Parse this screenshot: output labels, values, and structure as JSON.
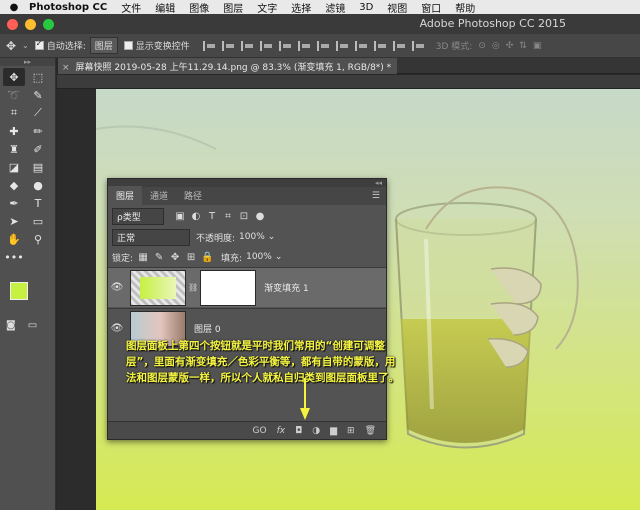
{
  "menubar": {
    "app": "Photoshop CC",
    "items": [
      "文件",
      "编辑",
      "图像",
      "图层",
      "文字",
      "选择",
      "滤镜",
      "3D",
      "视图",
      "窗口",
      "帮助"
    ]
  },
  "window": {
    "title": "Adobe Photoshop CC 2015",
    "traffic_colors": [
      "#ff5f57",
      "#febc2e",
      "#28c840"
    ]
  },
  "options_bar": {
    "auto_select_label": "自动选择:",
    "auto_select_value": "图层",
    "transform_controls_label": "显示变换控件",
    "mode_3d_label": "3D 模式:"
  },
  "document_tab": {
    "close": "×",
    "title": "屏幕快照 2019-05-28 上午11.29.14.png @ 83.3% (渐变填充 1, RGB/8*) *"
  },
  "colors": {
    "foreground": "#c6f042",
    "background": "#ffffff",
    "accent": "#f4f440"
  },
  "layers_panel": {
    "tabs": [
      "图层",
      "通道",
      "路径"
    ],
    "filter_label": "ρ类型",
    "blend_mode": "正常",
    "opacity_label": "不透明度:",
    "opacity_value": "100%",
    "lock_label": "锁定:",
    "fill_label": "填充:",
    "fill_value": "100%",
    "layers": [
      {
        "name": "渐变填充 1",
        "visible_icon": "👁"
      },
      {
        "name": "图层 0",
        "visible_icon": "👁"
      }
    ],
    "bottom_icons": [
      "GO",
      "fx",
      "◘",
      "◑",
      "▆",
      "⊞",
      "🗑"
    ]
  },
  "annotation": {
    "text": "图层面板上第四个按钮就是平时我们常用的“创建可调整层”，里面有渐变填充／色彩平衡等，都有自带的蒙版，用法和图层蒙版一样，所以个人就私自归类到图层面板里了。"
  }
}
